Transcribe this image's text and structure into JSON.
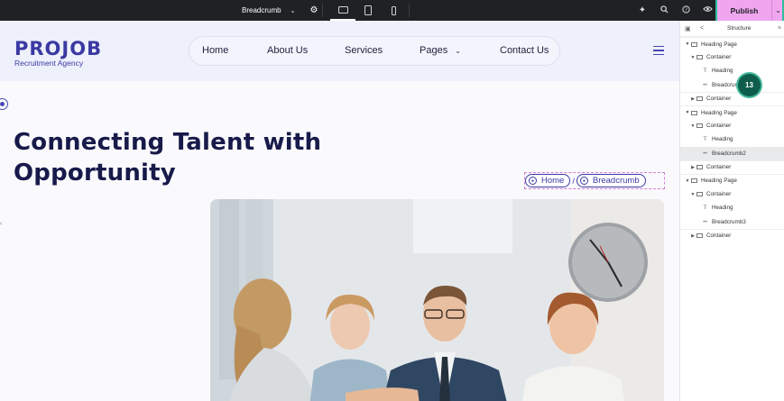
{
  "topbar": {
    "document_name": "Breadcrumb",
    "publish_label": "Publish",
    "step_number": "13",
    "icons": [
      "chevron-down-icon",
      "settings-icon",
      "desktop-icon",
      "tablet-icon",
      "mobile-icon",
      "sparkle-icon",
      "search-icon",
      "help-icon",
      "eye-icon"
    ]
  },
  "site": {
    "logo_main": "PROJOB",
    "logo_sub": "Recruitment Agency",
    "nav": [
      {
        "label": "Home"
      },
      {
        "label": "About Us"
      },
      {
        "label": "Services"
      },
      {
        "label": "Pages"
      },
      {
        "label": "Contact Us"
      }
    ],
    "heading_line1": "Connecting Talent with",
    "heading_line2": "Opportunity",
    "breadcrumb": [
      {
        "label": "Home"
      },
      {
        "label": "Breadcrumb"
      }
    ],
    "breadcrumb_separator": "/",
    "accent_color": "#3b3aa3"
  },
  "panel": {
    "title": "Structure",
    "tree": [
      {
        "label": "Heading Page",
        "kind": "group"
      },
      {
        "label": "Container"
      },
      {
        "label": "Heading"
      },
      {
        "label": "Breadcrumb"
      },
      {
        "label": "Container"
      },
      {
        "label": "Heading Page",
        "kind": "group"
      },
      {
        "label": "Container"
      },
      {
        "label": "Heading"
      },
      {
        "label": "Breadcrumb2",
        "selected": true
      },
      {
        "label": "Container"
      },
      {
        "label": "Heading Page",
        "kind": "group"
      },
      {
        "label": "Container"
      },
      {
        "label": "Heading"
      },
      {
        "label": "Breadcrumb3"
      },
      {
        "label": "Container"
      }
    ]
  }
}
